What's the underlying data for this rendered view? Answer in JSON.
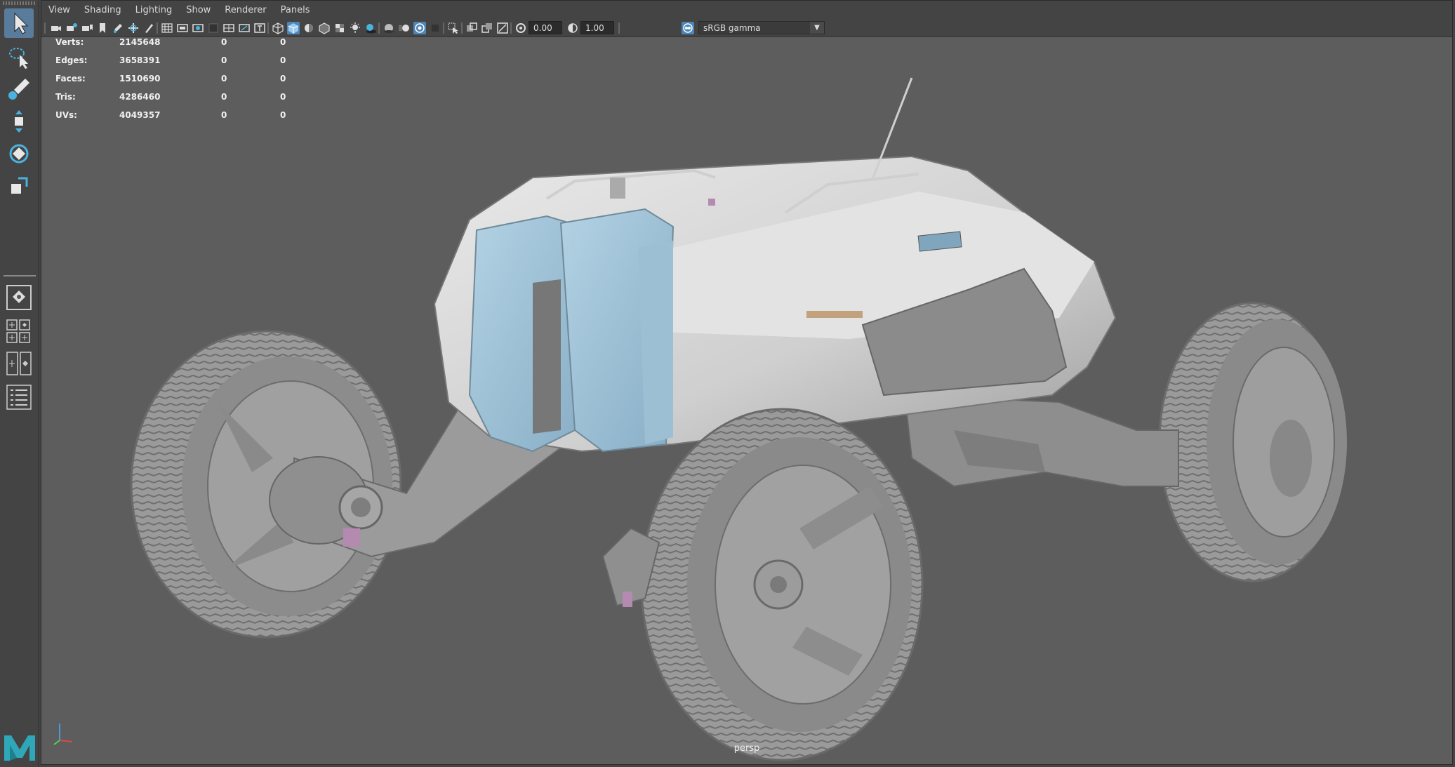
{
  "menubar": {
    "items": [
      "View",
      "Shading",
      "Lighting",
      "Show",
      "Renderer",
      "Panels"
    ]
  },
  "toolbar": {
    "exposure_value": "0.00",
    "gamma_value": "1.00",
    "color_space": "sRGB gamma"
  },
  "hud": {
    "rows": [
      {
        "label": "Verts:",
        "values": [
          "2145648",
          "0",
          "0"
        ]
      },
      {
        "label": "Edges:",
        "values": [
          "3658391",
          "0",
          "0"
        ]
      },
      {
        "label": "Faces:",
        "values": [
          "1510690",
          "0",
          "0"
        ]
      },
      {
        "label": "Tris:",
        "values": [
          "4286460",
          "0",
          "0"
        ]
      },
      {
        "label": "UVs:",
        "values": [
          "4049357",
          "0",
          "0"
        ]
      }
    ]
  },
  "viewport": {
    "camera": "persp"
  },
  "colors": {
    "viewport_bg": "#5d5d5d",
    "ui_bg": "#444444",
    "active_tool": "#5a7c9c",
    "glass_blue": "#9cc0d6",
    "maya_logo": "#2fa7b8"
  }
}
